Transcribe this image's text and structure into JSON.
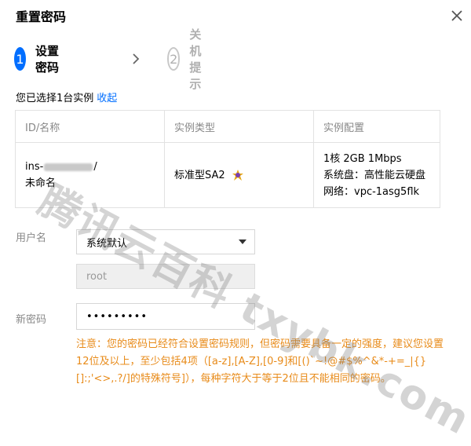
{
  "dialog": {
    "title": "重置密码"
  },
  "steps": [
    {
      "number": "1",
      "label": "设置密码"
    },
    {
      "number": "2",
      "label": "关机提示"
    }
  ],
  "selection": {
    "text": "您已选择1台实例",
    "collapse_link": "收起"
  },
  "table": {
    "headers": [
      "ID/名称",
      "实例类型",
      "实例配置"
    ],
    "row": {
      "id_prefix": "ins-",
      "id_suffix": "/",
      "name": "未命名",
      "type": "标准型SA2",
      "config_line1": "1核 2GB 1Mbps",
      "config_line2": "系统盘：高性能云硬盘",
      "config_line3": "网络：vpc-1asg5flk"
    }
  },
  "form": {
    "username_label": "用户名",
    "username_select_value": "系统默认",
    "username_value": "root",
    "password_label": "新密码",
    "password_value": "•••••••••"
  },
  "note": {
    "text": "注意：您的密码已经符合设置密码规则，但密码需要具备一定的强度，建议您设置12位及以上，至少包括4项（[a-z],[A-Z],[0-9]和[()`~!@#$%^&*-+=_|{}[]:;'<>,.?/]的特殊符号]），每种字符大于等于2位且不能相同的密码。"
  },
  "watermark": "腾讯云百科 txybk.com",
  "colors": {
    "accent": "#006eff",
    "warning": "#e88b1a",
    "muted": "#888888"
  }
}
